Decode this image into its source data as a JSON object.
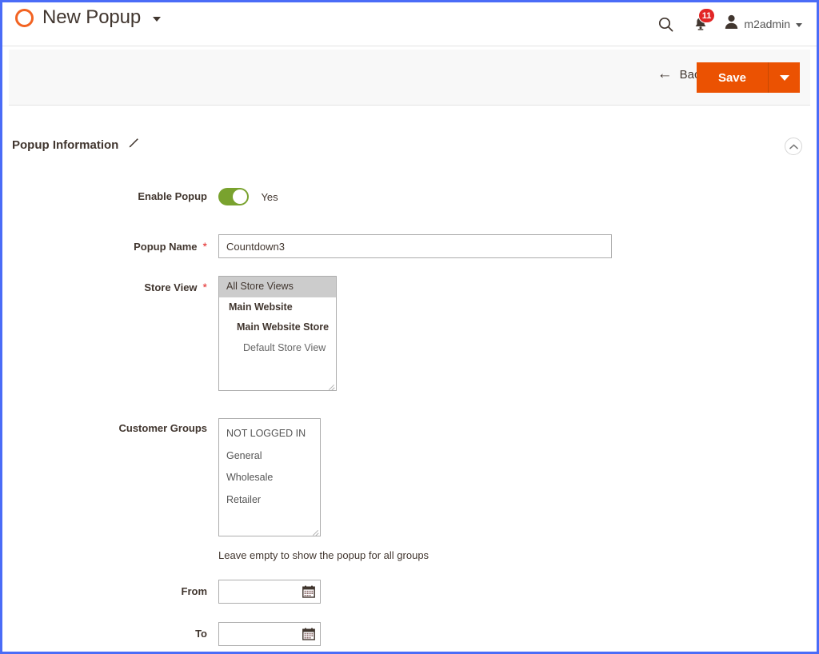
{
  "header": {
    "logo_icon": "magento-logo-icon",
    "page_title": "New Popup",
    "title_caret_icon": "caret-down-icon",
    "search_icon": "search-icon",
    "notifications_icon": "bell-icon",
    "notification_count": "11",
    "user_avatar_icon": "user-avatar-icon",
    "user_name": "m2admin",
    "user_caret_icon": "caret-down-icon"
  },
  "toolbar": {
    "back_label": "Back",
    "back_arrow_icon": "arrow-left-icon",
    "save_label": "Save",
    "save_caret_icon": "caret-down-icon"
  },
  "section": {
    "title": "Popup Information",
    "edit_icon": "pencil-icon",
    "collapse_icon": "chevron-up-icon"
  },
  "form": {
    "enable_popup": {
      "label": "Enable Popup",
      "value": "Yes",
      "toggle_state": "on"
    },
    "popup_name": {
      "label": "Popup Name",
      "required": "*",
      "value": "Countdown3",
      "placeholder": ""
    },
    "store_view": {
      "label": "Store View",
      "required": "*",
      "options": [
        {
          "label": "All Store Views",
          "level": "all",
          "selected": true
        },
        {
          "label": "Main Website",
          "level": "website",
          "selected": false
        },
        {
          "label": "Main Website Store",
          "level": "store",
          "selected": false
        },
        {
          "label": "Default Store View",
          "level": "storeview",
          "selected": false
        }
      ]
    },
    "customer_groups": {
      "label": "Customer Groups",
      "options": [
        {
          "label": "NOT LOGGED IN",
          "selected": false
        },
        {
          "label": "General",
          "selected": false
        },
        {
          "label": "Wholesale",
          "selected": false
        },
        {
          "label": "Retailer",
          "selected": false
        }
      ],
      "note": "Leave empty to show the popup for all groups"
    },
    "from_date": {
      "label": "From",
      "value": "",
      "placeholder": "",
      "calendar_icon": "calendar-icon"
    },
    "to_date": {
      "label": "To",
      "value": "",
      "placeholder": "",
      "calendar_icon": "calendar-icon"
    }
  },
  "colors": {
    "brand_orange": "#eb5202",
    "logo_orange": "#f26322",
    "toggle_green": "#79a22e",
    "badge_red": "#e22626",
    "required_red": "#e22626",
    "page_border_blue": "#4a6cf7",
    "toolbar_gray": "#f8f8f8",
    "text_dark": "#41362f"
  }
}
